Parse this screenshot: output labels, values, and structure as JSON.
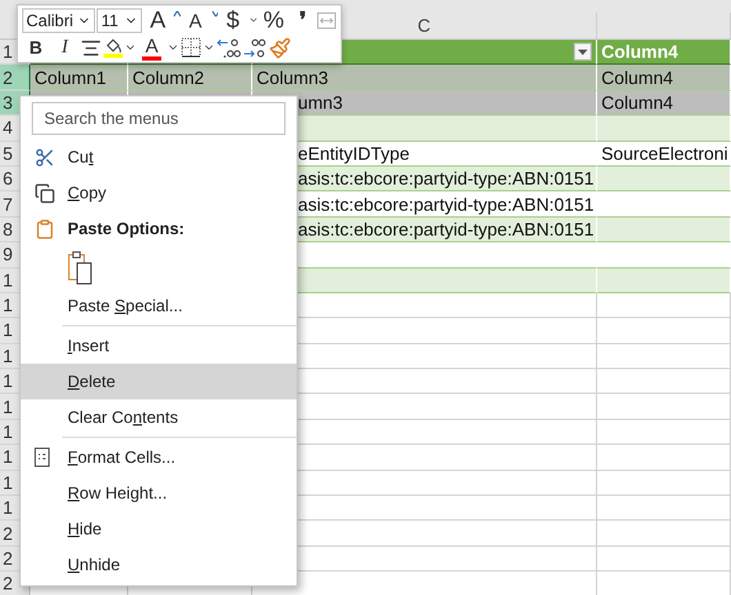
{
  "column_headers": {
    "c": "C"
  },
  "rows": [
    {
      "number": "1",
      "kind": "header",
      "selected": false,
      "cells": {
        "d": "Column4"
      }
    },
    {
      "number": "2",
      "kind": "band",
      "selected": true,
      "cells": {
        "a": "Column1",
        "b": "Column2",
        "c": "Column3",
        "d": "Column4"
      }
    },
    {
      "number": "3",
      "kind": "plain",
      "selected": true,
      "cells": {
        "c": "umn3",
        "d": "Column4"
      }
    },
    {
      "number": "4",
      "kind": "band",
      "selected": false,
      "cells": {}
    },
    {
      "number": "5",
      "kind": "plain",
      "selected": false,
      "cells": {
        "c": "eEntityIDType",
        "d": "SourceElectroni"
      }
    },
    {
      "number": "6",
      "kind": "band",
      "selected": false,
      "cells": {
        "c": "asis:tc:ebcore:partyid-type:ABN:0151"
      }
    },
    {
      "number": "7",
      "kind": "plain",
      "selected": false,
      "cells": {
        "c": "asis:tc:ebcore:partyid-type:ABN:0151"
      }
    },
    {
      "number": "8",
      "kind": "band",
      "selected": false,
      "cells": {
        "c": "asis:tc:ebcore:partyid-type:ABN:0151"
      }
    },
    {
      "number": "9",
      "kind": "plain",
      "selected": false,
      "cells": {}
    },
    {
      "number": "1",
      "kind": "band",
      "selected": false,
      "cells": {}
    },
    {
      "number": "1",
      "kind": "grid",
      "selected": false,
      "cells": {}
    },
    {
      "number": "1",
      "kind": "grid",
      "selected": false,
      "cells": {}
    },
    {
      "number": "1",
      "kind": "grid",
      "selected": false,
      "cells": {}
    },
    {
      "number": "1",
      "kind": "grid",
      "selected": false,
      "cells": {}
    },
    {
      "number": "1",
      "kind": "grid",
      "selected": false,
      "cells": {}
    },
    {
      "number": "1",
      "kind": "grid",
      "selected": false,
      "cells": {}
    },
    {
      "number": "1",
      "kind": "grid",
      "selected": false,
      "cells": {}
    },
    {
      "number": "1",
      "kind": "grid",
      "selected": false,
      "cells": {}
    },
    {
      "number": "1",
      "kind": "grid",
      "selected": false,
      "cells": {}
    },
    {
      "number": "2",
      "kind": "grid",
      "selected": false,
      "cells": {}
    },
    {
      "number": "2",
      "kind": "grid",
      "selected": false,
      "cells": {}
    },
    {
      "number": "2",
      "kind": "grid",
      "selected": false,
      "cells": {}
    }
  ],
  "mini_toolbar": {
    "font_controls": [
      {
        "kind": "font",
        "text": "Calibri"
      },
      {
        "kind": "size",
        "text": "11"
      },
      {
        "kind": "grow",
        "text": "A"
      },
      {
        "kind": "shrink",
        "text": "A"
      },
      {
        "kind": "currency",
        "text": "$"
      },
      {
        "kind": "glyph",
        "text": "%"
      },
      {
        "kind": "comma",
        "text": "❜"
      },
      {
        "kind": "wrap",
        "disabled": true
      }
    ],
    "format_controls": [
      {
        "kind": "bold",
        "text": "B"
      },
      {
        "kind": "italic",
        "text": "I"
      },
      {
        "kind": "center"
      },
      {
        "kind": "fill",
        "color": "#ffff00"
      },
      {
        "kind": "fontcolor",
        "text": "A",
        "color": "#ff0000"
      },
      {
        "kind": "borders"
      },
      {
        "kind": "decdec"
      },
      {
        "kind": "incdec"
      },
      {
        "kind": "painter"
      }
    ]
  },
  "context_menu": {
    "search": {
      "placeholder": "Search the menus"
    },
    "items": [
      {
        "kind": "cut",
        "label": {
          "before": "Cu",
          "key": "t"
        },
        "highlighted": false
      },
      {
        "kind": "copy",
        "label": {
          "key": "C",
          "after": "opy"
        },
        "highlighted": false
      },
      {
        "kind": "heading",
        "label": {
          "before": "Paste Options:"
        }
      },
      {
        "kind": "paste_option"
      },
      {
        "kind": "command",
        "label": {
          "before": "Paste ",
          "key": "S",
          "after": "pecial..."
        },
        "highlighted": false
      },
      {
        "kind": "separator"
      },
      {
        "kind": "command",
        "label": {
          "key": "I",
          "after": "nsert"
        },
        "highlighted": false
      },
      {
        "kind": "command",
        "label": {
          "key": "D",
          "after": "elete"
        },
        "highlighted": true
      },
      {
        "kind": "command",
        "label": {
          "before": "Clear Co",
          "key": "n",
          "after": "tents"
        },
        "highlighted": false
      },
      {
        "kind": "separator"
      },
      {
        "kind": "format",
        "label": {
          "key": "F",
          "after": "ormat Cells..."
        },
        "highlighted": false
      },
      {
        "kind": "command",
        "label": {
          "key": "R",
          "after": "ow Height..."
        },
        "highlighted": false
      },
      {
        "kind": "command",
        "label": {
          "key": "H",
          "after": "ide"
        },
        "highlighted": false
      },
      {
        "kind": "command",
        "label": {
          "key": "U",
          "after": "nhide"
        },
        "highlighted": false
      }
    ]
  }
}
